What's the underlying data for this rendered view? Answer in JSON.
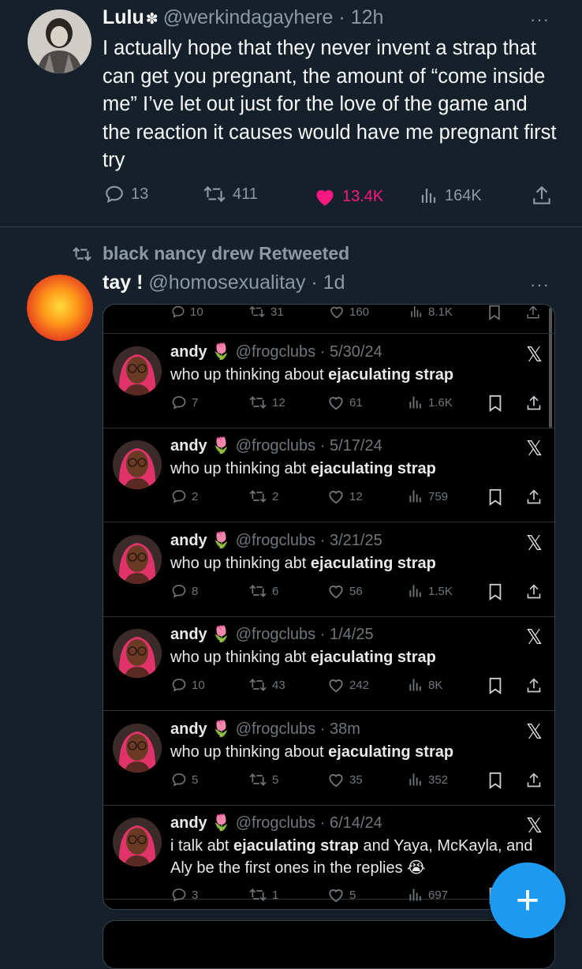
{
  "tweet1": {
    "name": "Lulu",
    "handle": "@werkindagayhere",
    "time": "12h",
    "more": "···",
    "text": "I actually hope that they never invent a strap that can get you pregnant, the amount of “come inside me” I’ve let out just for the love of the game and the reaction it causes would have me pregnant first try",
    "replies": "13",
    "retweets": "411",
    "likes": "13.4K",
    "views": "164K"
  },
  "retweet_line": {
    "text": "black nancy drew Retweeted"
  },
  "tweet2": {
    "name": "tay !",
    "handle": "@homosexualitay",
    "time": "1d",
    "more": "···"
  },
  "card": {
    "top_partial": {
      "replies": "10",
      "retweets": "31",
      "likes": "160",
      "views": "8.1K"
    },
    "posts": [
      {
        "name": "andy",
        "handle": "@frogclubs",
        "date": "5/30/24",
        "text_pre": "who up thinking about ",
        "text_bold": "ejaculating strap",
        "text_post": "",
        "replies": "7",
        "retweets": "12",
        "likes": "61",
        "views": "1.6K"
      },
      {
        "name": "andy",
        "handle": "@frogclubs",
        "date": "5/17/24",
        "text_pre": "who up thinking abt ",
        "text_bold": "ejaculating strap",
        "text_post": "",
        "replies": "2",
        "retweets": "2",
        "likes": "12",
        "views": "759"
      },
      {
        "name": "andy",
        "handle": "@frogclubs",
        "date": "3/21/25",
        "text_pre": "who up thinking abt ",
        "text_bold": "ejaculating strap",
        "text_post": "",
        "replies": "8",
        "retweets": "6",
        "likes": "56",
        "views": "1.5K"
      },
      {
        "name": "andy",
        "handle": "@frogclubs",
        "date": "1/4/25",
        "text_pre": "who up thinking abt ",
        "text_bold": "ejaculating strap",
        "text_post": "",
        "replies": "10",
        "retweets": "43",
        "likes": "242",
        "views": "8K"
      },
      {
        "name": "andy",
        "handle": "@frogclubs",
        "date": "38m",
        "text_pre": "who up thinking about ",
        "text_bold": "ejaculating strap",
        "text_post": "",
        "replies": "5",
        "retweets": "5",
        "likes": "35",
        "views": "352"
      },
      {
        "name": "andy",
        "handle": "@frogclubs",
        "date": "6/14/24",
        "text_pre": "i talk abt ",
        "text_bold": "ejaculating strap",
        "text_post": " and Yaya, McKayla, and Aly be the first ones in the replies 😭",
        "replies": "3",
        "retweets": "1",
        "likes": "5",
        "views": "697"
      }
    ],
    "x_logo": "𝕏",
    "name_emoji": "🌷"
  },
  "fab": {
    "label": "+"
  },
  "colors": {
    "background": "#15202b",
    "accent": "#1d9bf0",
    "like": "#f91880",
    "muted": "#8b98a5"
  },
  "icons": [
    "reply-icon",
    "retweet-icon",
    "heart-icon",
    "views-icon",
    "share-icon",
    "bookmark-icon",
    "verified-badge-icon",
    "more-icon",
    "x-logo-icon",
    "compose-icon"
  ]
}
